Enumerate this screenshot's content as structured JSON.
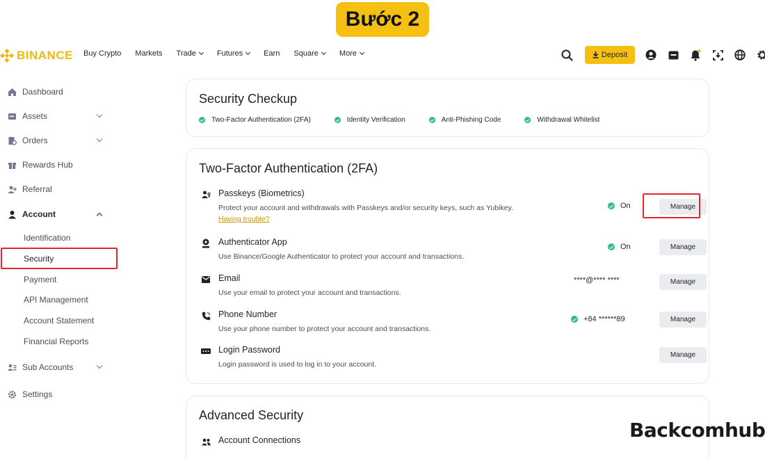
{
  "step_badge": "Bước 2",
  "brand": {
    "name": "BINANCE",
    "color": "#f0b90b"
  },
  "nav": [
    {
      "label": "Buy Crypto",
      "dropdown": false
    },
    {
      "label": "Markets",
      "dropdown": false
    },
    {
      "label": "Trade",
      "dropdown": true
    },
    {
      "label": "Futures",
      "dropdown": true
    },
    {
      "label": "Earn",
      "dropdown": false
    },
    {
      "label": "Square",
      "dropdown": true
    },
    {
      "label": "More",
      "dropdown": true
    }
  ],
  "header_right": {
    "search_icon": "search-icon",
    "deposit_label": "Deposit",
    "icons": [
      "user-icon",
      "wallet-icon",
      "bell-icon",
      "download-icon",
      "globe-icon",
      "gear-icon"
    ]
  },
  "sidebar": {
    "items": [
      {
        "label": "Dashboard",
        "icon": "home-icon"
      },
      {
        "label": "Assets",
        "icon": "wallet-icon",
        "expand": "down"
      },
      {
        "label": "Orders",
        "icon": "orders-icon",
        "expand": "down"
      },
      {
        "label": "Rewards Hub",
        "icon": "rewards-icon"
      },
      {
        "label": "Referral",
        "icon": "add-user-icon"
      },
      {
        "label": "Account",
        "icon": "user-icon",
        "expand": "up"
      }
    ],
    "account_sub": [
      "Identification",
      "Security",
      "Payment",
      "API Management",
      "Account Statement",
      "Financial Reports"
    ],
    "items_after": [
      {
        "label": "Sub Accounts",
        "icon": "sub-accounts-icon",
        "expand": "down"
      },
      {
        "label": "Settings",
        "icon": "gear-icon"
      }
    ]
  },
  "checkup": {
    "title": "Security Checkup",
    "items": [
      "Two-Factor Authentication (2FA)",
      "Identity Verification",
      "Anti-Phishing Code",
      "Withdrawal Whitelist"
    ]
  },
  "twofa": {
    "title": "Two-Factor Authentication (2FA)",
    "manage_label": "Manage",
    "methods": [
      {
        "name": "Passkeys (Biometrics)",
        "desc": "Protect your account and withdrawals with Passkeys and/or security keys, such as Yubikey.",
        "link": "Having trouble?",
        "status": "On",
        "icon": "passkey-icon"
      },
      {
        "name": "Authenticator App",
        "desc": "Use Binance/Google Authenticator to protect your account and transactions.",
        "status": "On",
        "icon": "authenticator-icon"
      },
      {
        "name": "Email",
        "desc": "Use your email to protect your account and transactions.",
        "status": "****@**** ****",
        "icon": "email-icon"
      },
      {
        "name": "Phone Number",
        "desc": "Use your phone number to protect your account and transactions.",
        "status": "+84 ******89",
        "icon": "phone-icon"
      },
      {
        "name": "Login Password",
        "desc": "Login password is used to log in to your account.",
        "status": "",
        "icon": "password-icon"
      }
    ]
  },
  "advanced": {
    "title": "Advanced Security",
    "items": [
      {
        "name": "Account Connections",
        "icon": "connections-icon"
      }
    ]
  },
  "watermark": "Backcomhub"
}
